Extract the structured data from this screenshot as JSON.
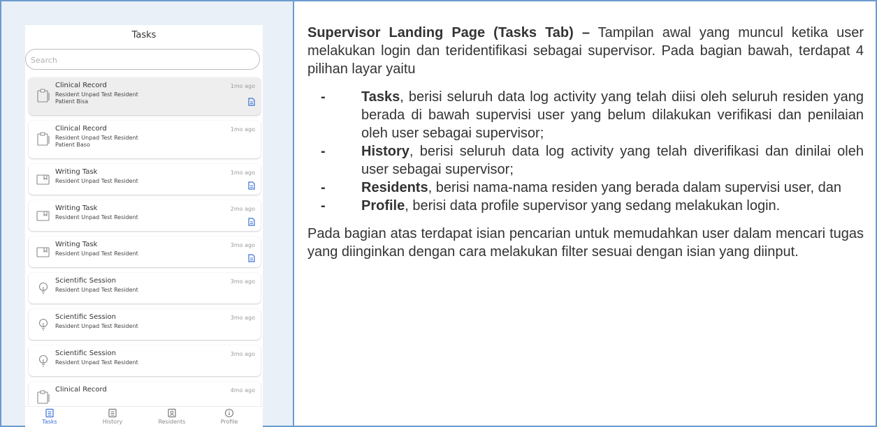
{
  "phone": {
    "title": "Tasks",
    "search": {
      "placeholder": "Search",
      "value": ""
    },
    "tasks": [
      {
        "title": "Clinical Record",
        "lines": [
          "Resident Unpad Test Resident",
          "Patient Bisa"
        ],
        "time": "1mo ago",
        "icon": "clipboard-icon",
        "has_document": true,
        "selected": true
      },
      {
        "title": "Clinical Record",
        "lines": [
          "Resident Unpad Test Resident",
          "Patient Baso"
        ],
        "time": "1mo ago",
        "icon": "clipboard-icon",
        "has_document": false,
        "selected": false
      },
      {
        "title": "Writing Task",
        "lines": [
          "Resident Unpad Test Resident"
        ],
        "time": "1mo ago",
        "icon": "book-icon",
        "has_document": true,
        "selected": false
      },
      {
        "title": "Writing Task",
        "lines": [
          "Resident Unpad Test Resident"
        ],
        "time": "2mo ago",
        "icon": "book-icon",
        "has_document": true,
        "selected": false
      },
      {
        "title": "Writing Task",
        "lines": [
          "Resident Unpad Test Resident"
        ],
        "time": "3mo ago",
        "icon": "book-icon",
        "has_document": true,
        "selected": false
      },
      {
        "title": "Scientific Session",
        "lines": [
          "Resident Unpad Test Resident"
        ],
        "time": "3mo ago",
        "icon": "lightbulb-icon",
        "has_document": false,
        "selected": false
      },
      {
        "title": "Scientific Session",
        "lines": [
          "Resident Unpad Test Resident"
        ],
        "time": "3mo ago",
        "icon": "lightbulb-icon",
        "has_document": false,
        "selected": false
      },
      {
        "title": "Scientific Session",
        "lines": [
          "Resident Unpad Test Resident"
        ],
        "time": "3mo ago",
        "icon": "lightbulb-icon",
        "has_document": false,
        "selected": false
      },
      {
        "title": "Clinical Record",
        "lines": [],
        "time": "4mo ago",
        "icon": "clipboard-icon",
        "has_document": false,
        "selected": false
      }
    ],
    "nav": [
      {
        "label": "Tasks",
        "icon": "tasks-icon",
        "active": true
      },
      {
        "label": "History",
        "icon": "history-icon",
        "active": false
      },
      {
        "label": "Residents",
        "icon": "residents-icon",
        "active": false
      },
      {
        "label": "Profile",
        "icon": "profile-info-icon",
        "active": false
      }
    ]
  },
  "description": {
    "intro_heading": "Supervisor Landing Page (Tasks Tab) –",
    "intro_text": " Tampilan awal yang muncul ketika user melakukan login dan teridentifikasi sebagai supervisor. Pada bagian bawah, terdapat 4 pilihan layar yaitu",
    "bullets": [
      {
        "term": "Tasks",
        "text": ",  berisi seluruh data log activity yang telah diisi oleh seluruh residen yang berada di bawah supervisi user yang belum dilakukan verifikasi dan penilaian oleh user sebagai supervisor;"
      },
      {
        "term": "History",
        "text": ",  berisi  seluruh  data  log  activity  yang  telah diverifikasi dan dinilai oleh user sebagai supervisor;"
      },
      {
        "term": "Residents",
        "text": ", berisi nama-nama residen yang berada dalam supervisi user, dan"
      },
      {
        "term": "Profile",
        "text": ",  berisi  data  profile  supervisor  yang  sedang melakukan login."
      }
    ],
    "bullet_marker": "-",
    "closing": "Pada bagian atas terdapat isian pencarian untuk memudahkan user dalam mencari tugas yang diinginkan dengan cara melakukan filter sesuai dengan isian yang diinput."
  },
  "colors": {
    "border": "#6b9bd0",
    "panel_bg": "#e9f0f8",
    "accent": "#3b6fd6",
    "muted": "#8a8a8a"
  }
}
